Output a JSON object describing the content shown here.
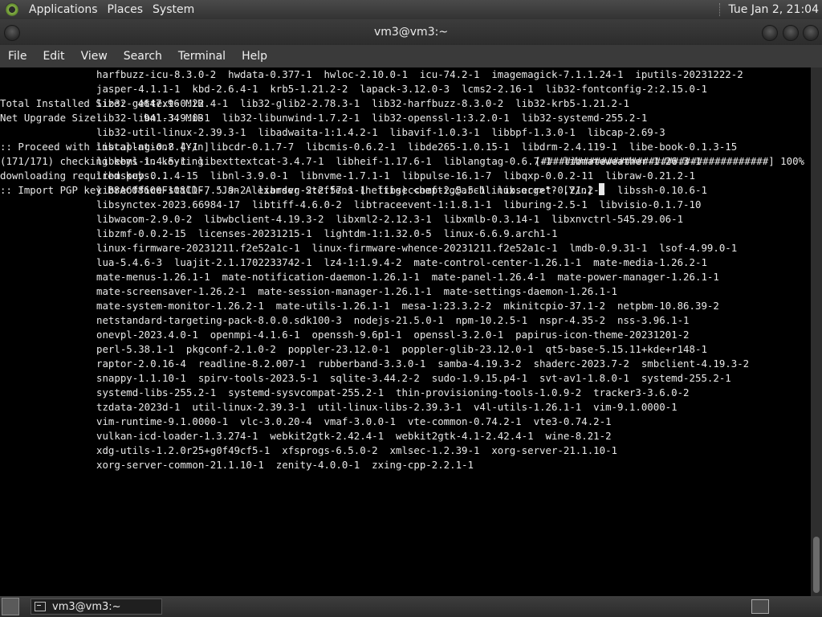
{
  "top_panel": {
    "menus": [
      "Applications",
      "Places",
      "System"
    ],
    "clock": "Tue Jan  2, 21:04"
  },
  "window": {
    "title": "vm3@vm3:~"
  },
  "menu_bar": [
    "File",
    "Edit",
    "View",
    "Search",
    "Terminal",
    "Help"
  ],
  "terminal": {
    "package_lines": [
      "harfbuzz-icu-8.3.0-2  hwdata-0.377-1  hwloc-2.10.0-1  icu-74.2-1  imagemagick-7.1.1.24-1  iputils-20231222-2",
      "jasper-4.1.1-1  kbd-2.6.4-1  krb5-1.21.2-2  lapack-3.12.0-3  lcms2-2.16-1  lib32-fontconfig-2:2.15.0-1",
      "lib32-gettext-0.22.4-1  lib32-glib2-2.78.3-1  lib32-harfbuzz-8.3.0-2  lib32-krb5-1.21.2-1",
      "lib32-libnl-3.9.0-1  lib32-libunwind-1.7.2-1  lib32-openssl-1:3.2.0-1  lib32-systemd-255.2-1",
      "lib32-util-linux-2.39.3-1  libadwaita-1:1.4.2-1  libavif-1.0.3-1  libbpf-1.3.0-1  libcap-2.69-3",
      "libcap-ng-0.8.4-1  libcdr-0.1.7-7  libcmis-0.6.2-1  libde265-1.0.15-1  libdrm-2.4.119-1  libe-book-0.1.3-15",
      "libebml-1.4.5-1  libexttextcat-3.4.7-1  libheif-1.17.6-1  liblangtag-0.6.7-1  libmateweather-1.26.3-1",
      "libmspub-0.1.4-15  libnl-3.9.0-1  libnvme-1.7.1-1  libpulse-16.1-7  libqxp-0.0.2-11  libraw-0.21.2-1",
      "libreoffice-still-7.5.9-2  librsvg-2:2.57.1-1  libseccomp-2.5.5-1  libsecret-0.21.2-1  libssh-0.10.6-1",
      "libsynctex-2023.66984-17  libtiff-4.6.0-2  libtraceevent-1:1.8.1-1  liburing-2.5-1  libvisio-0.1.7-10",
      "libwacom-2.9.0-2  libwbclient-4.19.3-2  libxml2-2.12.3-1  libxmlb-0.3.14-1  libxnvctrl-545.29.06-1",
      "libzmf-0.0.2-15  licenses-20231215-1  lightdm-1:1.32.0-5  linux-6.6.9.arch1-1",
      "linux-firmware-20231211.f2e52a1c-1  linux-firmware-whence-20231211.f2e52a1c-1  lmdb-0.9.31-1  lsof-4.99.0-1",
      "lua-5.4.6-3  luajit-2.1.1702233742-1  lz4-1:1.9.4-2  mate-control-center-1.26.1-1  mate-media-1.26.2-1",
      "mate-menus-1.26.1-1  mate-notification-daemon-1.26.1-1  mate-panel-1.26.4-1  mate-power-manager-1.26.1-1",
      "mate-screensaver-1.26.2-1  mate-session-manager-1.26.1-1  mate-settings-daemon-1.26.1-1",
      "mate-system-monitor-1.26.2-1  mate-utils-1.26.1-1  mesa-1:23.3.2-2  mkinitcpio-37.1-2  netpbm-10.86.39-2",
      "netstandard-targeting-pack-8.0.0.sdk100-3  nodejs-21.5.0-1  npm-10.2.5-1  nspr-4.35-2  nss-3.96.1-1",
      "onevpl-2023.4.0-1  openmpi-4.1.6-1  openssh-9.6p1-1  openssl-3.2.0-1  papirus-icon-theme-20231201-2",
      "perl-5.38.1-1  pkgconf-2.1.0-2  poppler-23.12.0-1  poppler-glib-23.12.0-1  qt5-base-5.15.11+kde+r148-1",
      "raptor-2.0.16-4  readline-8.2.007-1  rubberband-3.3.0-1  samba-4.19.3-2  shaderc-2023.7-2  smbclient-4.19.3-2",
      "snappy-1.1.10-1  spirv-tools-2023.5-1  sqlite-3.44.2-2  sudo-1.9.15.p4-1  svt-av1-1.8.0-1  systemd-255.2-1",
      "systemd-libs-255.2-1  systemd-sysvcompat-255.2-1  thin-provisioning-tools-1.0.9-2  tracker3-3.6.0-2",
      "tzdata-2023d-1  util-linux-2.39.3-1  util-linux-libs-2.39.3-1  v4l-utils-1.26.1-1  vim-9.1.0000-1",
      "vim-runtime-9.1.0000-1  vlc-3.0.20-4  vmaf-3.0.0-1  vte-common-0.74.2-1  vte3-0.74.2-1",
      "vulkan-icd-loader-1.3.274-1  webkit2gtk-2.42.4-1  webkit2gtk-4.1-2.42.4-1  wine-8.21-2",
      "xdg-utils-1.2.0r25+g0f49cf5-1  xfsprogs-6.5.0-2  xmlsec-1.2.39-1  xorg-server-21.1.10-1",
      "xorg-server-common-21.1.10-1  zenity-4.0.0-1  zxing-cpp-2.2.1-1"
    ],
    "total_installed_size": "Total Installed Size:  4647.96 MiB",
    "net_upgrade_size": "Net Upgrade Size:       941.34 MiB",
    "proceed_prompt": ":: Proceed with installation? [Y/n]",
    "checking_keys": "(171/171) checking keys in keyring",
    "progress_bar": "[######################################] 100%",
    "downloading_keys": "downloading required keys...",
    "import_prompt": ":: Import PGP key B8AC08600F108CDF, \"Jan Alexander Steffens (heftig) <heftig@archlinux.org>\"? [Y/n] "
  },
  "taskbar": {
    "task_label": "vm3@vm3:~"
  }
}
